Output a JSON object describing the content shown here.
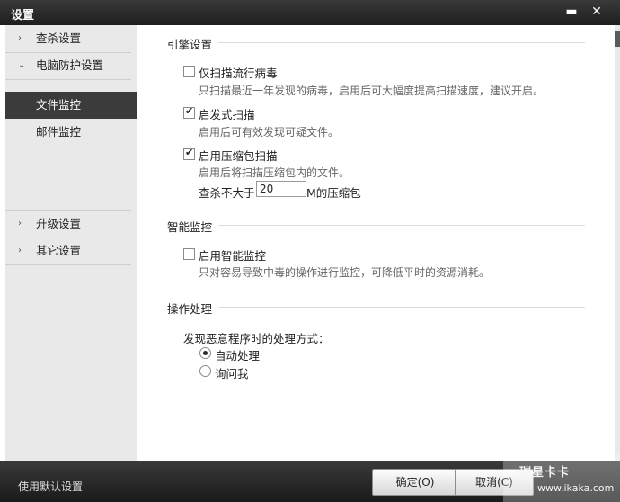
{
  "window": {
    "title": "设置",
    "minimize_glyph": "▬",
    "close_glyph": "✕"
  },
  "sidebar": {
    "items": [
      {
        "label": "查杀设置",
        "chevron": "›"
      },
      {
        "label": "电脑防护设置",
        "chevron": "⌄"
      },
      {
        "label": "升级设置",
        "chevron": "›"
      },
      {
        "label": "其它设置",
        "chevron": "›"
      }
    ],
    "subitems": [
      {
        "label": "文件监控",
        "active": true
      },
      {
        "label": "邮件监控",
        "active": false
      }
    ]
  },
  "engine": {
    "heading": "引擎设置",
    "options": [
      {
        "label": "仅扫描流行病毒",
        "checked": false,
        "desc": "只扫描最近一年发现的病毒，启用后可大幅度提高扫描速度，建议开启。"
      },
      {
        "label": "启发式扫描",
        "checked": true,
        "desc": "启用后可有效发现可疑文件。"
      },
      {
        "label": "启用压缩包扫描",
        "checked": true,
        "desc": "启用后将扫描压缩包内的文件。"
      }
    ],
    "size_prefix": "查杀不大于",
    "size_value": "20",
    "size_suffix": "M的压缩包"
  },
  "smart": {
    "heading": "智能监控",
    "option": {
      "label": "启用智能监控",
      "checked": false,
      "desc": "只对容易导致中毒的操作进行监控，可降低平时的资源消耗。"
    }
  },
  "action": {
    "heading": "操作处理",
    "prompt": "发现恶意程序时的处理方式：",
    "radios": [
      {
        "label": "自动处理",
        "selected": true
      },
      {
        "label": "询问我",
        "selected": false
      }
    ]
  },
  "footer": {
    "defaults_label": "使用默认设置",
    "ok_label": "确定(O)",
    "cancel_label": "取消(C)"
  },
  "watermark": {
    "text": "瑞星卡卡",
    "url": "www.ikaka.com"
  },
  "colors": {
    "titlebar": "#2a2a2a",
    "sidebar_bg": "#e9e9e9",
    "active_item": "#3b3b3b",
    "footer": "#2a2a2a"
  },
  "icons": {
    "checkbox_tick": "✔"
  }
}
